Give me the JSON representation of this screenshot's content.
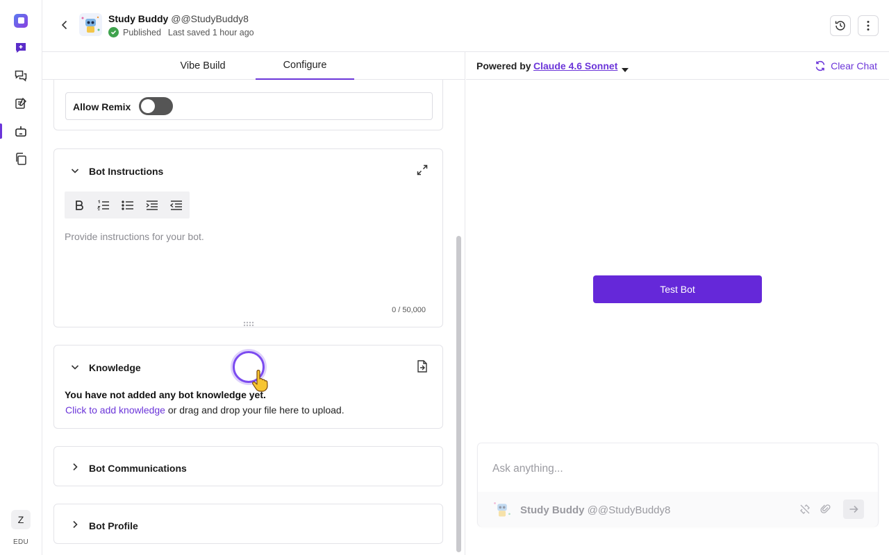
{
  "rail": {
    "items": [
      "logo-icon",
      "new-chat-icon",
      "chats-icon",
      "notes-icon",
      "bots-icon",
      "library-icon"
    ],
    "user_initial": "Z",
    "plan": "EDU"
  },
  "header": {
    "bot_name": "Study Buddy",
    "bot_handle": "@@StudyBuddy8",
    "status": "Published",
    "last_saved": "Last saved 1 hour ago"
  },
  "tabs": [
    {
      "label": "Vibe Build",
      "active": false
    },
    {
      "label": "Configure",
      "active": true
    }
  ],
  "settings": {
    "allow_remix_label": "Allow Remix",
    "allow_remix_on": false
  },
  "instructions": {
    "title": "Bot Instructions",
    "placeholder": "Provide instructions for your bot.",
    "counter": "0 / 50,000",
    "toolbar": [
      "bold-icon",
      "numbered-list-icon",
      "bulleted-list-icon",
      "indent-icon",
      "outdent-icon"
    ]
  },
  "knowledge": {
    "title": "Knowledge",
    "empty": "You have not added any bot knowledge yet.",
    "link": "Click to add knowledge",
    "suffix": " or drag and drop your file here to upload."
  },
  "communications": {
    "title": "Bot Communications"
  },
  "profile": {
    "title": "Bot Profile"
  },
  "chat": {
    "powered_by": "Powered by",
    "model": "Claude 4.6 Sonnet",
    "clear": "Clear Chat",
    "test_button": "Test Bot",
    "input_placeholder": "Ask anything...",
    "bot_name": "Study Buddy",
    "bot_handle": "@@StudyBuddy8"
  },
  "colors": {
    "accent": "#6b35d9",
    "published": "#3fa34d"
  }
}
